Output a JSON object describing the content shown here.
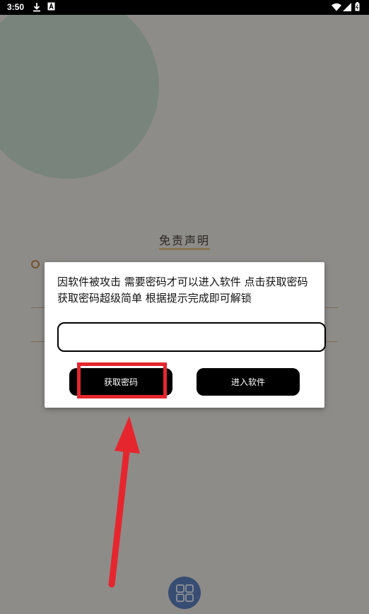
{
  "status_bar": {
    "time": "3:50"
  },
  "page": {
    "title": "免责声明"
  },
  "dialog": {
    "message": "因软件被攻击 需要密码才可以进入软件 点击获取密码 获取密码超级简单 根据提示完成即可解锁",
    "password_value": "",
    "get_password_label": "获取密码",
    "enter_app_label": "进入软件"
  },
  "annotation": {
    "highlight_color": "#e6262e",
    "arrow_color": "#e6262e"
  },
  "colors": {
    "dialog_button": "#000000",
    "fab": "#5f86c4",
    "accent_circle": "#cfe4d6"
  }
}
